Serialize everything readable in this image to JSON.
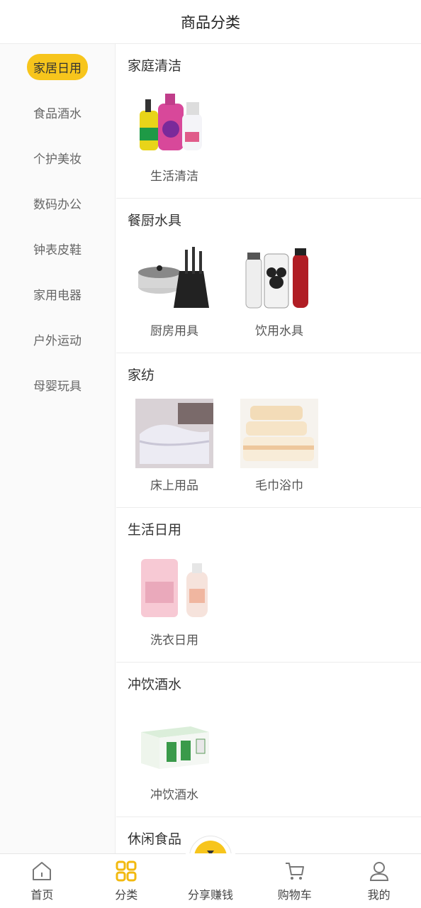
{
  "header": {
    "title": "商品分类"
  },
  "sidebar": {
    "items": [
      {
        "label": "家居日用",
        "active": true
      },
      {
        "label": "食品酒水",
        "active": false
      },
      {
        "label": "个护美妆",
        "active": false
      },
      {
        "label": "数码办公",
        "active": false
      },
      {
        "label": "钟表皮鞋",
        "active": false
      },
      {
        "label": "家用电器",
        "active": false
      },
      {
        "label": "户外运动",
        "active": false
      },
      {
        "label": "母婴玩具",
        "active": false
      }
    ]
  },
  "sections": [
    {
      "title": "家庭清洁",
      "products": [
        {
          "label": "生活清洁",
          "icon": "cleaning-bottles-image"
        }
      ]
    },
    {
      "title": "餐厨水具",
      "products": [
        {
          "label": "厨房用具",
          "icon": "cookware-image"
        },
        {
          "label": "饮用水具",
          "icon": "water-bottles-image"
        }
      ]
    },
    {
      "title": "家纺",
      "products": [
        {
          "label": "床上用品",
          "icon": "bedding-image"
        },
        {
          "label": "毛巾浴巾",
          "icon": "towels-image"
        }
      ]
    },
    {
      "title": "生活日用",
      "products": [
        {
          "label": "洗衣日用",
          "icon": "laundry-image"
        }
      ]
    },
    {
      "title": "冲饮酒水",
      "products": [
        {
          "label": "冲饮酒水",
          "icon": "drink-box-image"
        }
      ]
    },
    {
      "title": "休闲食品",
      "products": []
    }
  ],
  "tabbar": {
    "tabs": [
      {
        "label": "首页",
        "icon": "home-icon"
      },
      {
        "label": "分类",
        "icon": "category-icon"
      },
      {
        "label": "分享赚钱",
        "icon": "money-bag-icon"
      },
      {
        "label": "购物车",
        "icon": "cart-icon"
      },
      {
        "label": "我的",
        "icon": "user-icon"
      }
    ]
  },
  "colors": {
    "accent": "#f7c51c",
    "text": "#333333",
    "muted": "#666666",
    "divider": "#ececec"
  }
}
